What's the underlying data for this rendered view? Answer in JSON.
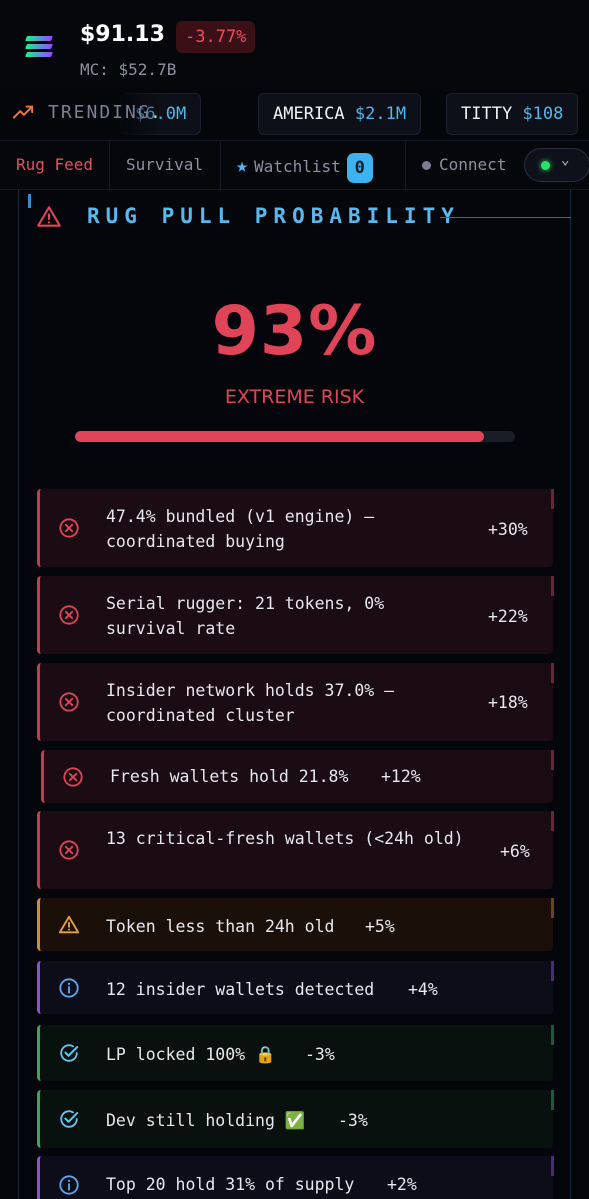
{
  "header": {
    "price": "$91.13",
    "change": "-3.77%",
    "market_cap": "MC: $52.7B",
    "logo_icon": "solana-logo-icon"
  },
  "trending": {
    "label": "TRENDING",
    "icon": "trending-up-icon",
    "chips": [
      {
        "symbol": "",
        "volume": "$6.0M"
      },
      {
        "symbol": "AMERICA",
        "volume": "$2.1M"
      },
      {
        "symbol": "TITTY",
        "volume": "$108"
      }
    ]
  },
  "nav": {
    "rug_feed": "Rug Feed",
    "survival": "Survival",
    "watchlist": "Watchlist",
    "watchlist_count": "0",
    "connect": "Connect"
  },
  "panel": {
    "title": "RUG PULL PROBABILITY",
    "title_icon": "warning-triangle-icon",
    "probability": "93%",
    "probability_value": 0.93,
    "risk_level": "EXTREME RISK"
  },
  "factors": [
    {
      "severity": "critical",
      "icon": "x-circle-icon",
      "text": "47.4% bundled (v1 engine) — coordinated buying",
      "weight": "+30%"
    },
    {
      "severity": "critical",
      "icon": "x-circle-icon",
      "text": "Serial rugger: 21 tokens, 0% survival rate",
      "weight": "+22%"
    },
    {
      "severity": "critical",
      "icon": "x-circle-icon",
      "text": "Insider network holds 37.0% — coordinated cluster",
      "weight": "+18%"
    },
    {
      "severity": "critical",
      "icon": "x-circle-icon",
      "text": "Fresh wallets hold 21.8%",
      "weight": "+12%"
    },
    {
      "severity": "critical",
      "icon": "x-circle-icon",
      "text": "13 critical-fresh wallets (<24h old)",
      "weight": "+6%"
    },
    {
      "severity": "warn",
      "icon": "warning-triangle-icon",
      "text": "Token less than 24h old",
      "weight": "+5%"
    },
    {
      "severity": "info",
      "icon": "info-circle-icon",
      "text": "12 insider wallets detected",
      "weight": "+4%"
    },
    {
      "severity": "good",
      "icon": "check-circle-icon",
      "text": "LP locked 100% 🔒",
      "weight": "-3%"
    },
    {
      "severity": "good",
      "icon": "check-circle-icon",
      "text": "Dev still holding ✅",
      "weight": "-3%"
    },
    {
      "severity": "info",
      "icon": "info-circle-icon",
      "text": "Top 20 hold 31% of supply",
      "weight": "+2%"
    }
  ]
}
